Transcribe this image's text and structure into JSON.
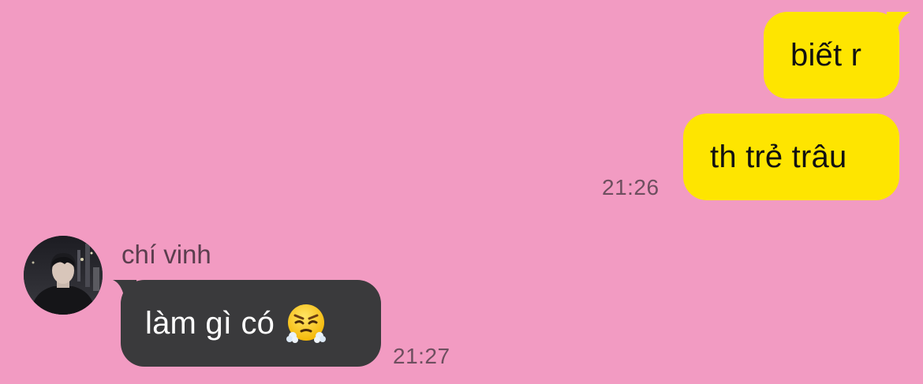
{
  "messages": [
    {
      "direction": "outgoing",
      "text": "biết r"
    },
    {
      "direction": "outgoing",
      "text": "th trẻ trâu",
      "time": "21:26"
    },
    {
      "direction": "incoming",
      "sender": "chí vinh",
      "text": "làm gì có",
      "emoji": "face-with-steam-from-nose",
      "time": "21:27"
    }
  ],
  "colors": {
    "background": "#f29bc2",
    "outgoing_bubble": "#fee500",
    "incoming_bubble": "#3a3a3c",
    "timestamp": "#6e4f5f"
  }
}
